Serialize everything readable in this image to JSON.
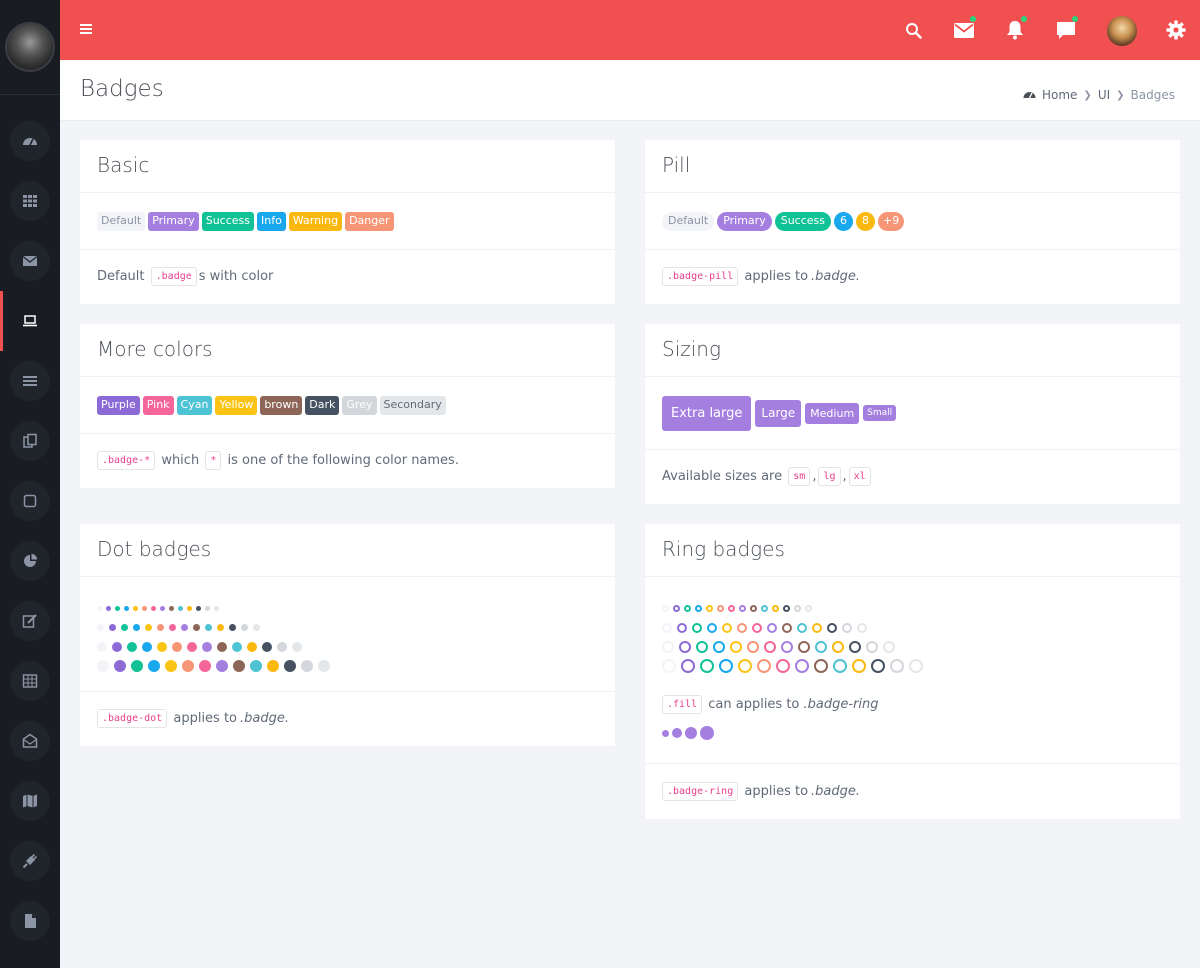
{
  "topbar": {
    "icons": [
      "menu-icon",
      "search-icon",
      "mail-icon",
      "bell-icon",
      "chat-icon",
      "avatar",
      "gear-icon"
    ]
  },
  "sidebar": {
    "icons": [
      "dashboard-icon",
      "grid-icon",
      "mail-icon",
      "laptop-icon",
      "list-icon",
      "pages-icon",
      "square-icon",
      "pie-chart-icon",
      "edit-icon",
      "table-icon",
      "envelope-open-icon",
      "map-icon",
      "plug-icon",
      "file-icon"
    ],
    "active": "laptop-icon"
  },
  "header": {
    "title": "Badges",
    "breadcrumb": [
      "Home",
      "UI",
      "Badges"
    ]
  },
  "colors": {
    "default": "#f3f4f7",
    "primary": "#a57fe0",
    "success": "#12c297",
    "info": "#19a7ee",
    "warning": "#fbb910",
    "danger": "#f79577",
    "purple": "#8d6bd7",
    "pink": "#f4669a",
    "cyan": "#4ec3d3",
    "yellow": "#fbc414",
    "brown": "#8d6658",
    "dark": "#465161",
    "grey": "#d3d6db",
    "secondary": "#e4e7ea",
    "topbar": "#f05050",
    "sidebar": "#191c23"
  },
  "basic": {
    "title": "Basic",
    "badges": [
      {
        "label": "Default",
        "color": "default"
      },
      {
        "label": "Primary",
        "color": "primary"
      },
      {
        "label": "Success",
        "color": "success"
      },
      {
        "label": "Info",
        "color": "info"
      },
      {
        "label": "Warning",
        "color": "warning"
      },
      {
        "label": "Danger",
        "color": "danger"
      }
    ],
    "foot_pre": "Default",
    "foot_code": ".badge",
    "foot_post": "s with color"
  },
  "pill": {
    "title": "Pill",
    "badges": [
      {
        "label": "Default",
        "color": "default"
      },
      {
        "label": "Primary",
        "color": "primary"
      },
      {
        "label": "Success",
        "color": "success"
      },
      {
        "label": "6",
        "color": "info"
      },
      {
        "label": "8",
        "color": "warning"
      },
      {
        "label": "+9",
        "color": "danger"
      }
    ],
    "foot_code": ".badge-pill",
    "foot_text": "applies to",
    "foot_em": ".badge."
  },
  "more_colors": {
    "title": "More colors",
    "badges": [
      {
        "label": "Purple",
        "color": "purple"
      },
      {
        "label": "Pink",
        "color": "pink"
      },
      {
        "label": "Cyan",
        "color": "cyan"
      },
      {
        "label": "Yellow",
        "color": "yellow"
      },
      {
        "label": "brown",
        "color": "brown"
      },
      {
        "label": "Dark",
        "color": "dark"
      },
      {
        "label": "Grey",
        "color": "grey"
      },
      {
        "label": "Secondary",
        "color": "secondary"
      }
    ],
    "foot_code1": ".badge-*",
    "foot_mid": "which",
    "foot_code2": "*",
    "foot_post": "is one of the following color names."
  },
  "sizing": {
    "title": "Sizing",
    "badges": [
      {
        "label": "Extra large",
        "size": "xl"
      },
      {
        "label": "Large",
        "size": "lg"
      },
      {
        "label": "Medium",
        "size": "md"
      },
      {
        "label": "Small",
        "size": "sm"
      }
    ],
    "foot_pre": "Available sizes are",
    "codes": [
      "sm",
      "lg",
      "xl"
    ]
  },
  "dot_badges": {
    "title": "Dot badges",
    "colors": [
      "default",
      "purple",
      "success",
      "info",
      "yellow",
      "danger",
      "pink",
      "primary",
      "brown",
      "cyan",
      "warning",
      "dark",
      "grey",
      "secondary"
    ],
    "foot_code": ".badge-dot",
    "foot_text": "applies to",
    "foot_em": ".badge."
  },
  "ring_badges": {
    "title": "Ring badges",
    "colors": [
      "default",
      "purple",
      "success",
      "info",
      "yellow",
      "danger",
      "pink",
      "primary",
      "brown",
      "cyan",
      "warning",
      "dark",
      "grey",
      "secondary"
    ],
    "fill_code": ".fill",
    "fill_text": "can applies to",
    "fill_em": ".badge-ring",
    "foot_code": ".badge-ring",
    "foot_text": "applies to",
    "foot_em": ".badge."
  }
}
